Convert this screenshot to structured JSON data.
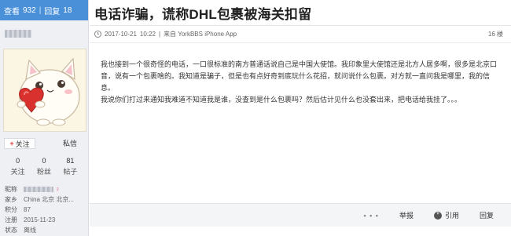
{
  "stats": {
    "views_label": "查看",
    "views": "932",
    "sep": "|",
    "replies_label": "回复",
    "replies": "18"
  },
  "post": {
    "title": "电话诈骗，谎称DHL包裹被海关扣留",
    "date": "2017-10-21",
    "time": "10:22",
    "source_sep": "|",
    "source": "来自 YorkBBS iPhone App",
    "floor": "16 楼",
    "paragraph1": "我也接到一个很奇怪的电话，一口很标准的南方普通话说自己是中国大使馆。我印象里大使馆还是北方人居多啊，很多是北京口音，说有一个包裹啥的。我知道是骗子，但是也有点好奇到底玩什么花招，就问说什么包裹。对方就一直问我是哪里，我的信息。",
    "paragraph2": "我说你们打过来通知我难道不知道我是谁，没查到是什么包裹吗？然后估计见什么也没套出来，把电话给我挂了。。。"
  },
  "user": {
    "follow_label": "关注",
    "message_label": "私信",
    "following_count": "0",
    "following_label": "关注",
    "fans_count": "0",
    "fans_label": "粉丝",
    "posts_count": "81",
    "posts_label": "帖子",
    "nickname_key": "昵称",
    "hometown_key": "家乡",
    "hometown_value": "China 北京 北京...",
    "points_key": "积分",
    "points_value": "87",
    "registered_key": "注册",
    "registered_value": "2015-11-23",
    "status_key": "状态",
    "status_value": "离线"
  },
  "actions": {
    "more": "• • •",
    "report": "举报",
    "quote": "引用",
    "reply": "回复"
  },
  "icons": {
    "clock": "clock-icon",
    "quote": "quote-icon",
    "more": "more-dots-icon"
  },
  "colors": {
    "accent": "#4a90d9",
    "follow_plus": "#e0383e",
    "female": "#e05a8c"
  }
}
